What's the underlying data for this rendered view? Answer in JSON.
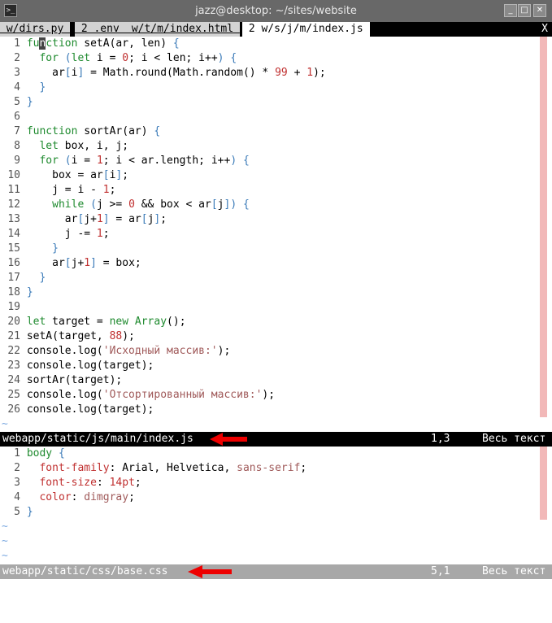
{
  "window": {
    "title": "jazz@desktop: ~/sites/website",
    "minimize_glyph": "_",
    "maximize_glyph": "□",
    "close_glyph": "✕"
  },
  "tabs": [
    {
      "label": " w/dirs.py ",
      "active": false
    },
    {
      "label": " 2 .env ",
      "active": false
    },
    {
      "label": " w/t/m/index.html ",
      "active": false
    },
    {
      "label": " 2 w/s/j/m/index.js ",
      "active": true
    }
  ],
  "tab_close": "X",
  "js_pane": {
    "lines": [
      {
        "n": "1",
        "tokens": [
          [
            "kw",
            "fu"
          ],
          [
            "cur",
            "n"
          ],
          [
            "kw",
            "ction"
          ],
          [
            "id",
            " setA(ar, len) "
          ],
          [
            "br",
            "{"
          ]
        ]
      },
      {
        "n": "2",
        "tokens": [
          [
            "id",
            "  "
          ],
          [
            "kw",
            "for"
          ],
          [
            "id",
            " "
          ],
          [
            "br",
            "("
          ],
          [
            "kw",
            "let"
          ],
          [
            "id",
            " i = "
          ],
          [
            "num",
            "0"
          ],
          [
            "id",
            "; i < len; i++"
          ],
          [
            "br",
            ")"
          ],
          [
            "id",
            " "
          ],
          [
            "br",
            "{"
          ]
        ]
      },
      {
        "n": "3",
        "tokens": [
          [
            "id",
            "    ar"
          ],
          [
            "br",
            "["
          ],
          [
            "id",
            "i"
          ],
          [
            "br",
            "]"
          ],
          [
            "id",
            " = Math.round(Math.random() * "
          ],
          [
            "num",
            "99"
          ],
          [
            "id",
            " + "
          ],
          [
            "num",
            "1"
          ],
          [
            "id",
            ");"
          ]
        ]
      },
      {
        "n": "4",
        "tokens": [
          [
            "id",
            "  "
          ],
          [
            "br",
            "}"
          ]
        ]
      },
      {
        "n": "5",
        "tokens": [
          [
            "br",
            "}"
          ]
        ]
      },
      {
        "n": "6",
        "tokens": []
      },
      {
        "n": "7",
        "tokens": [
          [
            "kw",
            "function"
          ],
          [
            "id",
            " sortAr(ar) "
          ],
          [
            "br",
            "{"
          ]
        ]
      },
      {
        "n": "8",
        "tokens": [
          [
            "id",
            "  "
          ],
          [
            "kw",
            "let"
          ],
          [
            "id",
            " box, i, j;"
          ]
        ]
      },
      {
        "n": "9",
        "tokens": [
          [
            "id",
            "  "
          ],
          [
            "kw",
            "for"
          ],
          [
            "id",
            " "
          ],
          [
            "br",
            "("
          ],
          [
            "id",
            "i = "
          ],
          [
            "num",
            "1"
          ],
          [
            "id",
            "; i < ar.length; i++"
          ],
          [
            "br",
            ")"
          ],
          [
            "id",
            " "
          ],
          [
            "br",
            "{"
          ]
        ]
      },
      {
        "n": "10",
        "tokens": [
          [
            "id",
            "    box = ar"
          ],
          [
            "br",
            "["
          ],
          [
            "id",
            "i"
          ],
          [
            "br",
            "]"
          ],
          [
            "id",
            ";"
          ]
        ]
      },
      {
        "n": "11",
        "tokens": [
          [
            "id",
            "    j = i - "
          ],
          [
            "num",
            "1"
          ],
          [
            "id",
            ";"
          ]
        ]
      },
      {
        "n": "12",
        "tokens": [
          [
            "id",
            "    "
          ],
          [
            "kw",
            "while"
          ],
          [
            "id",
            " "
          ],
          [
            "br",
            "("
          ],
          [
            "id",
            "j >= "
          ],
          [
            "num",
            "0"
          ],
          [
            "id",
            " && box < ar"
          ],
          [
            "br",
            "["
          ],
          [
            "id",
            "j"
          ],
          [
            "br",
            "]"
          ],
          [
            "br",
            ")"
          ],
          [
            "id",
            " "
          ],
          [
            "br",
            "{"
          ]
        ]
      },
      {
        "n": "13",
        "tokens": [
          [
            "id",
            "      ar"
          ],
          [
            "br",
            "["
          ],
          [
            "id",
            "j+"
          ],
          [
            "num",
            "1"
          ],
          [
            "br",
            "]"
          ],
          [
            "id",
            " = ar"
          ],
          [
            "br",
            "["
          ],
          [
            "id",
            "j"
          ],
          [
            "br",
            "]"
          ],
          [
            "id",
            ";"
          ]
        ]
      },
      {
        "n": "14",
        "tokens": [
          [
            "id",
            "      j -= "
          ],
          [
            "num",
            "1"
          ],
          [
            "id",
            ";"
          ]
        ]
      },
      {
        "n": "15",
        "tokens": [
          [
            "id",
            "    "
          ],
          [
            "br",
            "}"
          ]
        ]
      },
      {
        "n": "16",
        "tokens": [
          [
            "id",
            "    ar"
          ],
          [
            "br",
            "["
          ],
          [
            "id",
            "j+"
          ],
          [
            "num",
            "1"
          ],
          [
            "br",
            "]"
          ],
          [
            "id",
            " = box;"
          ]
        ]
      },
      {
        "n": "17",
        "tokens": [
          [
            "id",
            "  "
          ],
          [
            "br",
            "}"
          ]
        ]
      },
      {
        "n": "18",
        "tokens": [
          [
            "br",
            "}"
          ]
        ]
      },
      {
        "n": "19",
        "tokens": []
      },
      {
        "n": "20",
        "tokens": [
          [
            "kw",
            "let"
          ],
          [
            "id",
            " target = "
          ],
          [
            "kw",
            "new"
          ],
          [
            "id",
            " "
          ],
          [
            "ty",
            "Array"
          ],
          [
            "id",
            "();"
          ]
        ]
      },
      {
        "n": "21",
        "tokens": [
          [
            "id",
            "setA(target, "
          ],
          [
            "num",
            "88"
          ],
          [
            "id",
            ");"
          ]
        ]
      },
      {
        "n": "22",
        "tokens": [
          [
            "id",
            "console.log("
          ],
          [
            "str",
            "'Исходный массив:'"
          ],
          [
            "id",
            ");"
          ]
        ]
      },
      {
        "n": "23",
        "tokens": [
          [
            "id",
            "console.log(target);"
          ]
        ]
      },
      {
        "n": "24",
        "tokens": [
          [
            "id",
            "sortAr(target);"
          ]
        ]
      },
      {
        "n": "25",
        "tokens": [
          [
            "id",
            "console.log("
          ],
          [
            "str",
            "'Отсортированный массив:'"
          ],
          [
            "id",
            ");"
          ]
        ]
      },
      {
        "n": "26",
        "tokens": [
          [
            "id",
            "console.log(target);"
          ]
        ]
      }
    ],
    "tilde": "~",
    "status": {
      "file": "webapp/static/js/main/index.js",
      "position": "1,3",
      "percent": "Весь текст"
    }
  },
  "css_pane": {
    "lines": [
      {
        "n": "1",
        "tokens": [
          [
            "kw",
            "body"
          ],
          [
            "id",
            " "
          ],
          [
            "br",
            "{"
          ]
        ]
      },
      {
        "n": "2",
        "tokens": [
          [
            "id",
            "  "
          ],
          [
            "prop",
            "font-family"
          ],
          [
            "id",
            ": Arial, Helvetica, "
          ],
          [
            "val",
            "sans-serif"
          ],
          [
            "id",
            ";"
          ]
        ]
      },
      {
        "n": "3",
        "tokens": [
          [
            "id",
            "  "
          ],
          [
            "prop",
            "font-size"
          ],
          [
            "id",
            ": "
          ],
          [
            "num",
            "14pt"
          ],
          [
            "id",
            ";"
          ]
        ]
      },
      {
        "n": "4",
        "tokens": [
          [
            "id",
            "  "
          ],
          [
            "prop",
            "color"
          ],
          [
            "id",
            ": "
          ],
          [
            "val",
            "dimgray"
          ],
          [
            "id",
            ";"
          ]
        ]
      },
      {
        "n": "5",
        "tokens": [
          [
            "br",
            "}"
          ]
        ]
      }
    ],
    "tilde": "~",
    "status": {
      "file": "webapp/static/css/base.css",
      "position": "5,1",
      "percent": "Весь текст"
    }
  },
  "colors": {
    "arrow": "#ee0000",
    "color_column": "#f2b8b8",
    "keyword": "#1e8a2e",
    "number": "#c03030",
    "string": "#a05a5a",
    "bracket": "#3a7ab8"
  }
}
